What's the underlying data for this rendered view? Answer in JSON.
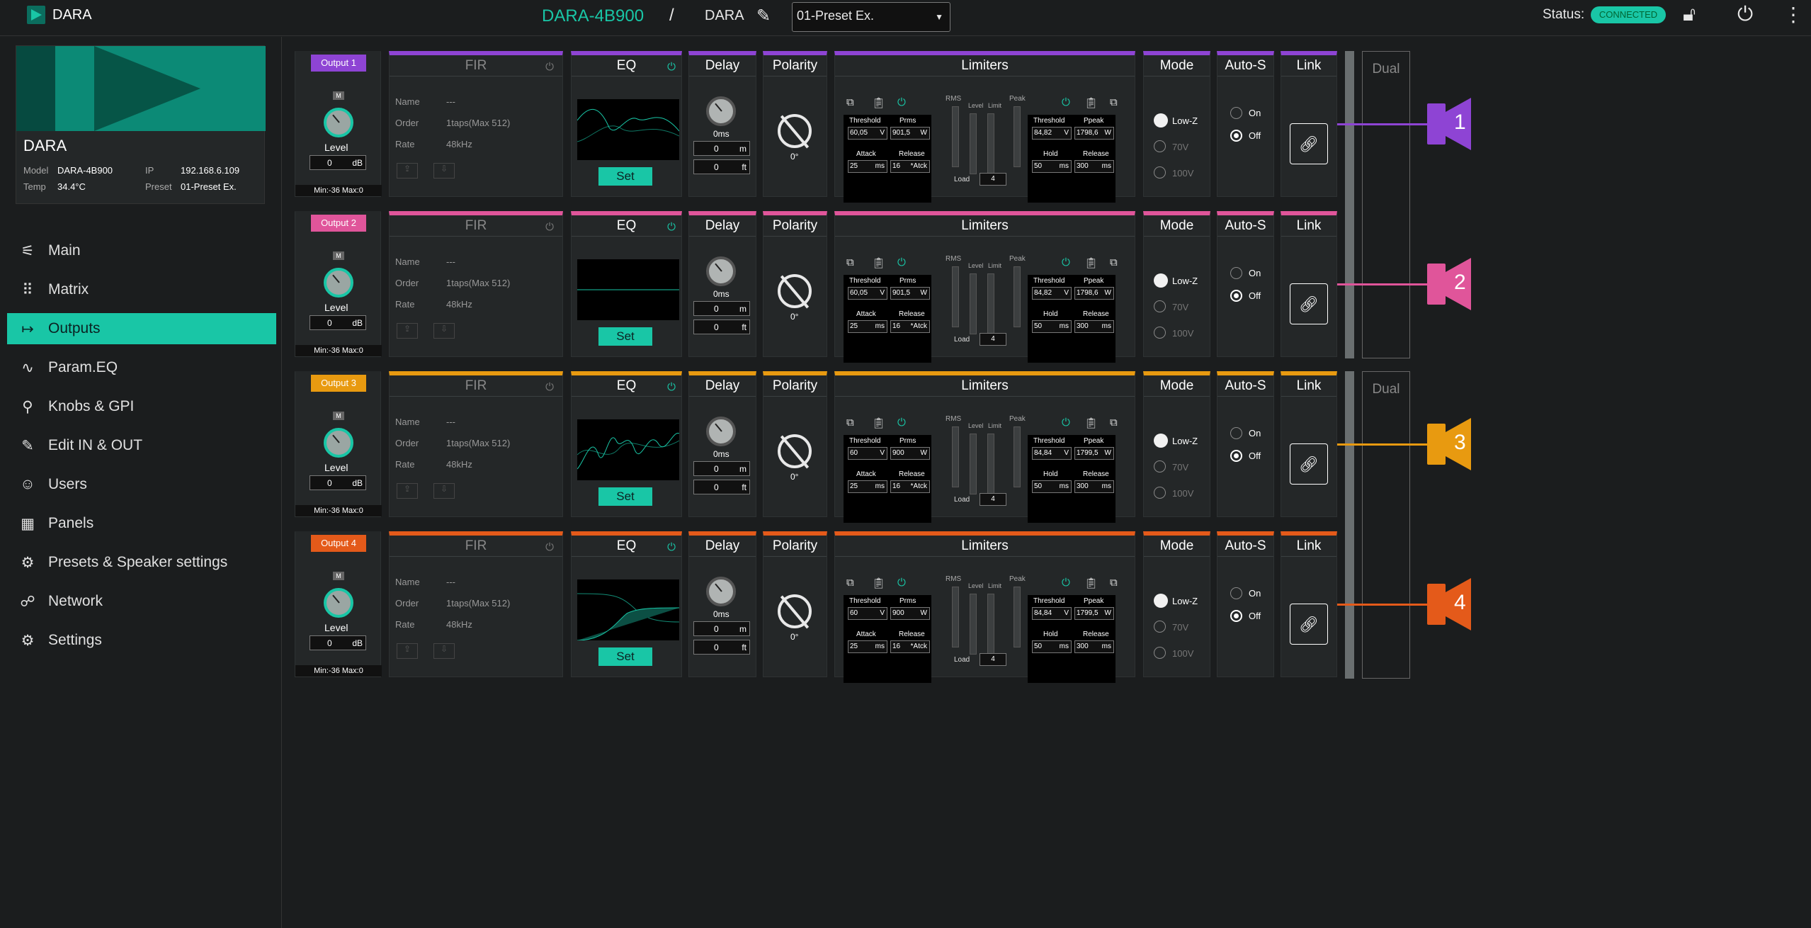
{
  "header": {
    "brand": "DARA",
    "device_title": "DARA-4B900",
    "separator": "/",
    "device_name": "DARA",
    "preset_selected": "01-Preset Ex.",
    "status_label": "Status:",
    "status_value": "CONNECTED",
    "icons": {
      "edit": "pencil-icon",
      "lock": "unlock-icon",
      "power": "power-icon",
      "menu": "more-vertical-icon",
      "caret": "caret-down-icon"
    }
  },
  "device_card": {
    "name": "DARA",
    "model_label": "Model",
    "model": "DARA-4B900",
    "ip_label": "IP",
    "ip": "192.168.6.109",
    "temp_label": "Temp",
    "temp": "34.4°C",
    "preset_label": "Preset",
    "preset": "01-Preset Ex."
  },
  "nav": [
    {
      "label": "Main",
      "icon": "sliders-icon"
    },
    {
      "label": "Matrix",
      "icon": "grid-icon"
    },
    {
      "label": "Outputs",
      "icon": "output-icon",
      "active": true
    },
    {
      "label": "Param.EQ",
      "icon": "eq-curve-icon"
    },
    {
      "label": "Knobs & GPI",
      "icon": "knob-icon"
    },
    {
      "label": "Edit IN & OUT",
      "icon": "pencil-icon"
    },
    {
      "label": "Users",
      "icon": "user-icon"
    },
    {
      "label": "Panels",
      "icon": "panel-icon"
    },
    {
      "label": "Presets & Speaker settings",
      "icon": "preset-icon"
    },
    {
      "label": "Network",
      "icon": "network-icon"
    },
    {
      "label": "Settings",
      "icon": "gear-icon"
    }
  ],
  "headers": {
    "fir": "FIR",
    "eq": "EQ",
    "delay": "Delay",
    "polarity": "Polarity",
    "limiters": "Limiters",
    "mode": "Mode",
    "autos": "Auto-S",
    "link": "Link",
    "dual": "Dual"
  },
  "labels": {
    "mute": "M",
    "level": "Level",
    "db": "dB",
    "minmax": "Min:-36  Max:0",
    "name": "Name",
    "order": "Order",
    "rate": "Rate",
    "set": "Set",
    "m": "m",
    "ft": "ft",
    "rms": "RMS",
    "peak": "Peak",
    "level_col": "Level",
    "limit_col": "Limit",
    "load": "Load",
    "threshold": "Threshold",
    "prms": "Prms",
    "ppeak": "Ppeak",
    "attack": "Attack",
    "release": "Release",
    "hold": "Hold",
    "v": "V",
    "w": "W",
    "ms": "ms",
    "atck": "*Atck",
    "lowz": "Low-Z",
    "v70": "70V",
    "v100": "100V",
    "on": "On",
    "off": "Off"
  },
  "outputs": [
    {
      "name": "Output 1",
      "color": "#8e44d4",
      "number": "1",
      "level": "0",
      "fir_name": "---",
      "fir_order": "1taps(Max 512)",
      "fir_rate": "48kHz",
      "delay_ms": "0ms",
      "delay_m": "0",
      "delay_ft": "0",
      "polarity": "0°",
      "rms_threshold": "60,05",
      "prms": "901,5",
      "attack": "25",
      "release": "16",
      "load": "4",
      "peak_threshold": "84,82",
      "ppeak": "1798,6",
      "hold": "50",
      "peak_release": "300",
      "mode": "Low-Z",
      "autos": "Off",
      "eq_curve": "wavy"
    },
    {
      "name": "Output 2",
      "color": "#e0559a",
      "number": "2",
      "level": "0",
      "fir_name": "---",
      "fir_order": "1taps(Max 512)",
      "fir_rate": "48kHz",
      "delay_ms": "0ms",
      "delay_m": "0",
      "delay_ft": "0",
      "polarity": "0°",
      "rms_threshold": "60,05",
      "prms": "901,5",
      "attack": "25",
      "release": "16",
      "load": "4",
      "peak_threshold": "84,82",
      "ppeak": "1798,6",
      "hold": "50",
      "peak_release": "300",
      "mode": "Low-Z",
      "autos": "Off",
      "eq_curve": "flat"
    },
    {
      "name": "Output 3",
      "color": "#e89a10",
      "number": "3",
      "level": "0",
      "fir_name": "---",
      "fir_order": "1taps(Max 512)",
      "fir_rate": "48kHz",
      "delay_ms": "0ms",
      "delay_m": "0",
      "delay_ft": "0",
      "polarity": "0°",
      "rms_threshold": "60",
      "prms": "900",
      "attack": "25",
      "release": "16",
      "load": "4",
      "peak_threshold": "84,84",
      "ppeak": "1799,5",
      "hold": "50",
      "peak_release": "300",
      "mode": "Low-Z",
      "autos": "Off",
      "eq_curve": "jagged"
    },
    {
      "name": "Output 4",
      "color": "#e45a1a",
      "number": "4",
      "level": "0",
      "fir_name": "---",
      "fir_order": "1taps(Max 512)",
      "fir_rate": "48kHz",
      "delay_ms": "0ms",
      "delay_m": "0",
      "delay_ft": "0",
      "polarity": "0°",
      "rms_threshold": "60",
      "prms": "900",
      "attack": "25",
      "release": "16",
      "load": "4",
      "peak_threshold": "84,84",
      "ppeak": "1799,5",
      "hold": "50",
      "peak_release": "300",
      "mode": "Low-Z",
      "autos": "Off",
      "eq_curve": "crossover"
    }
  ],
  "colors": {
    "accent": "#19c6a6"
  }
}
